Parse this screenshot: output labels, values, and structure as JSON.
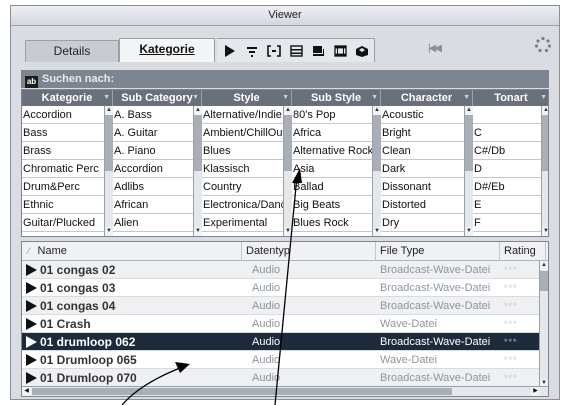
{
  "window": {
    "title": "Viewer"
  },
  "tabs": [
    {
      "label": "Details",
      "active": false
    },
    {
      "label": "Kategorie",
      "active": true
    }
  ],
  "toolbar_icons": [
    "play-icon",
    "filter-lines-icon",
    "bracket-frame-icon",
    "list-icon",
    "disk-icon",
    "grid-icon",
    "cube-icon"
  ],
  "search": {
    "badge": "ab",
    "label": "Suchen nach:"
  },
  "filters": [
    {
      "header": "Kategorie",
      "items": [
        "Accordion",
        "Bass",
        "Brass",
        "Chromatic Perc",
        "Drum&Perc",
        "Ethnic",
        "Guitar/Plucked"
      ]
    },
    {
      "header": "Sub Category",
      "items": [
        "A. Bass",
        "A. Guitar",
        "A. Piano",
        "Accordion",
        "Adlibs",
        "African",
        "Alien"
      ]
    },
    {
      "header": "Style",
      "items": [
        "Alternative/Indie",
        "Ambient/ChillOut",
        "Blues",
        "Klassisch",
        "Country",
        "Electronica/Dance",
        "Experimental"
      ]
    },
    {
      "header": "Sub Style",
      "items": [
        "80's Pop",
        "Africa",
        "Alternative Rock",
        "Asia",
        "Ballad",
        "Big Beats",
        "Blues Rock"
      ]
    },
    {
      "header": "Character",
      "items": [
        "Acoustic",
        "Bright",
        "Clean",
        "Dark",
        "Dissonant",
        "Distorted",
        "Dry"
      ]
    },
    {
      "header": "Tonart",
      "items": [
        "",
        "C",
        "C#/Db",
        "D",
        "D#/Eb",
        "E",
        "F"
      ]
    }
  ],
  "results": {
    "columns": {
      "name": "Name",
      "type": "Datentyp",
      "file": "File Type",
      "rating": "Rating"
    },
    "rows": [
      {
        "name": "01 congas 02",
        "type": "Audio",
        "file": "Broadcast-Wave-Datei",
        "rating": "***"
      },
      {
        "name": "01 congas 03",
        "type": "Audio",
        "file": "Broadcast-Wave-Datei",
        "rating": "***"
      },
      {
        "name": "01 congas 04",
        "type": "Audio",
        "file": "Broadcast-Wave-Datei",
        "rating": "***"
      },
      {
        "name": "01 Crash",
        "type": "Audio",
        "file": "Wave-Datei",
        "rating": "***"
      },
      {
        "name": "01 drumloop 062",
        "type": "Audio",
        "file": "Broadcast-Wave-Datei",
        "rating": "***",
        "selected": true
      },
      {
        "name": "01 Drumloop 065",
        "type": "Audio",
        "file": "Wave-Datei",
        "rating": "***"
      },
      {
        "name": "01 Drumloop 070",
        "type": "Audio",
        "file": "Broadcast-Wave-Datei",
        "rating": "***"
      }
    ]
  }
}
